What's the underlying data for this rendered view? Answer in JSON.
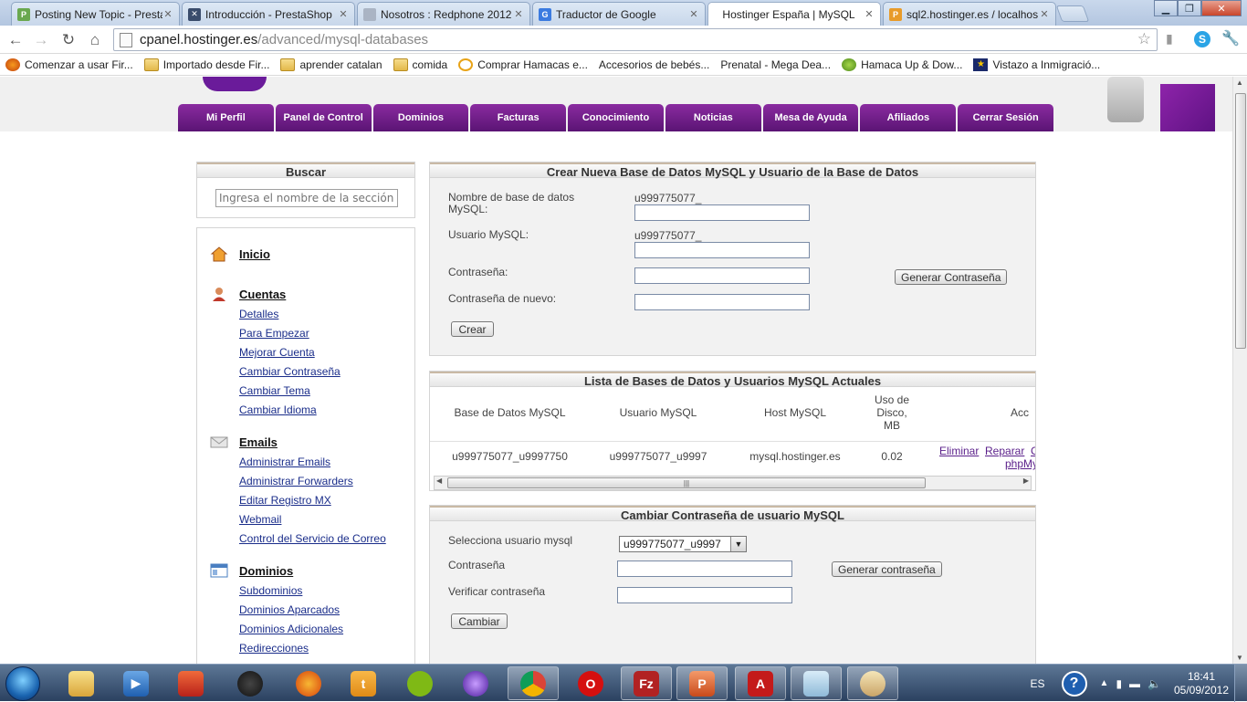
{
  "browser": {
    "tabs": [
      {
        "title": "Posting New Topic - Presta",
        "active": false
      },
      {
        "title": "Introducción - PrestaShop",
        "active": false
      },
      {
        "title": "Nosotros : Redphone 2012",
        "active": false
      },
      {
        "title": "Traductor de Google",
        "active": false
      },
      {
        "title": "Hostinger España | MySQL",
        "active": true
      },
      {
        "title": "sql2.hostinger.es / localhos",
        "active": false
      }
    ],
    "url_host": "cpanel.hostinger.es",
    "url_path": "/advanced/mysql-databases",
    "bookmarks": [
      {
        "label": "Comenzar a usar Fir...",
        "icon": "firefox-icon"
      },
      {
        "label": "Importado desde Fir...",
        "icon": "folder-icon"
      },
      {
        "label": "aprender catalan",
        "icon": "folder-icon"
      },
      {
        "label": "comida",
        "icon": "folder-icon"
      },
      {
        "label": "Comprar Hamacas e...",
        "icon": "hamaca-icon"
      },
      {
        "label": "Accesorios de bebés...",
        "icon": "page-icon"
      },
      {
        "label": "Prenatal - Mega Dea...",
        "icon": "page-icon"
      },
      {
        "label": "Hamaca Up & Dow...",
        "icon": "hamaca-up-icon"
      },
      {
        "label": "Vistazo a Inmigració...",
        "icon": "star-icon"
      }
    ]
  },
  "nav": {
    "items": [
      "Mi Perfil",
      "Panel de Control",
      "Dominios",
      "Facturas",
      "Conocimiento",
      "Noticias",
      "Mesa de Ayuda",
      "Afiliados",
      "Cerrar Sesión"
    ]
  },
  "search": {
    "title": "Buscar",
    "placeholder": "Ingresa el nombre de la sección..."
  },
  "sidebar": {
    "sections": [
      {
        "title": "Inicio",
        "links": []
      },
      {
        "title": "Cuentas",
        "links": [
          "Detalles",
          "Para Empezar",
          "Mejorar Cuenta",
          "Cambiar Contraseña",
          "Cambiar Tema",
          "Cambiar Idioma"
        ]
      },
      {
        "title": "Emails",
        "links": [
          "Administrar Emails",
          "Administrar Forwarders",
          "Editar Registro MX",
          "Webmail",
          "Control del Servicio de Correo"
        ]
      },
      {
        "title": "Dominios",
        "links": [
          "Subdominios",
          "Dominios Aparcados",
          "Dominios Adicionales",
          "Redirecciones"
        ]
      }
    ]
  },
  "create_panel": {
    "title": "Crear Nueva Base de Datos MySQL y Usuario de la Base de Datos",
    "db_name_label": "Nombre de base de datos MySQL:",
    "db_prefix": "u999775077_",
    "user_label": "Usuario MySQL:",
    "user_prefix": "u999775077_",
    "password_label": "Contraseña:",
    "password_again_label": "Contraseña de nuevo:",
    "generate_button": "Generar Contraseña",
    "create_button": "Crear"
  },
  "list_panel": {
    "title": "Lista de Bases de Datos y Usuarios MySQL Actuales",
    "headers": [
      "Base de Datos MySQL",
      "Usuario MySQL",
      "Host MySQL",
      "Uso de Disco, MB",
      "Acc"
    ],
    "rows": [
      {
        "db": "u999775077_u9997750",
        "user": "u999775077_u9997",
        "host": "mysql.hostinger.es",
        "usage": "0.02",
        "actions": [
          "Eliminar",
          "Reparar",
          "C",
          "phpMy"
        ]
      }
    ]
  },
  "change_panel": {
    "title": "Cambiar Contraseña de usuario MySQL",
    "select_label": "Selecciona usuario mysql",
    "select_value": "u999775077_u9997",
    "password_label": "Contraseña",
    "verify_label": "Verificar contraseña",
    "generate_button": "Generar contraseña",
    "change_button": "Cambiar"
  },
  "taskbar": {
    "apps": [
      "explorer",
      "media-player",
      "paint",
      "dvd",
      "firefox",
      "uTorrent",
      "spotify",
      "itunes",
      "chrome",
      "opera",
      "filezilla",
      "powerpoint",
      "acrobat",
      "notepad",
      "paint-app"
    ],
    "lang": "ES",
    "time": "18:41",
    "date": "05/09/2012"
  },
  "colors": {
    "nav_purple": "#6a1b9a",
    "link_blue": "#1a2d8a",
    "action_purple": "#5a1f8a"
  }
}
